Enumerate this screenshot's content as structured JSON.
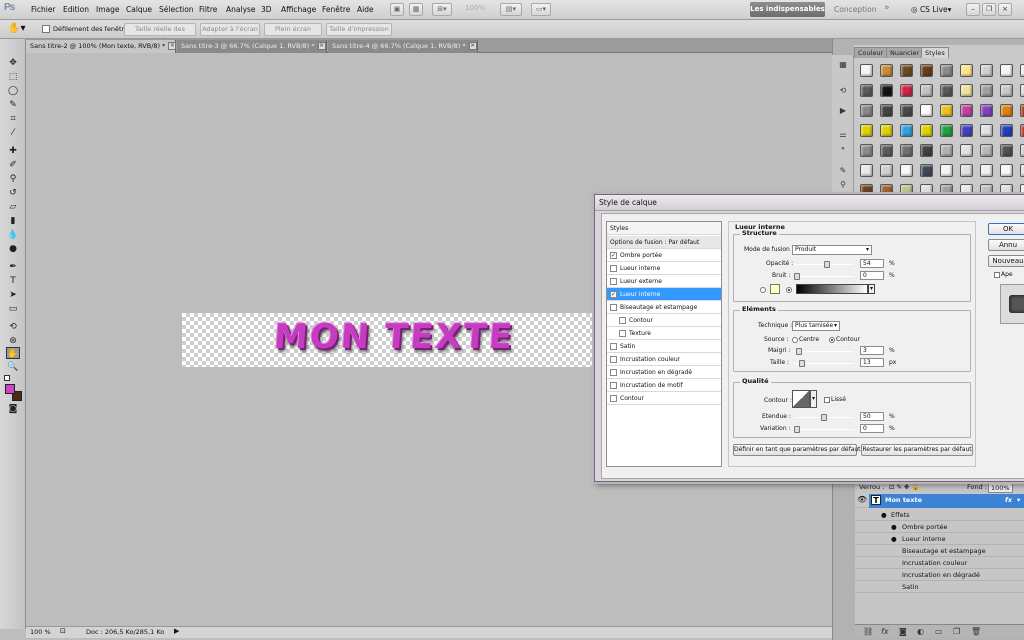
{
  "app": {
    "logo": "Ps"
  },
  "menu": [
    "Fichier",
    "Edition",
    "Image",
    "Calque",
    "Sélection",
    "Filtre",
    "Analyse",
    "3D",
    "Affichage",
    "Fenêtre",
    "Aide"
  ],
  "menubar": {
    "zoom": "100%",
    "workspace_active": "Les indispensables",
    "workspace_other": "Conception",
    "more": "»",
    "cslive": "CS Live"
  },
  "options": {
    "scroll_all": "Défilement des fenêtres",
    "btn_actual": "Taille réelle des pixels",
    "btn_fit": "Adapter à l'écran",
    "btn_full": "Plein écran",
    "btn_print": "Taille d'impression"
  },
  "tabs": [
    {
      "label": "Sans titre-2 @ 100% (Mon texte, RVB/8) *",
      "close": "×"
    },
    {
      "label": "Sans titre-3 @ 66.7% (Calque 1, RVB/8) *",
      "close": "×"
    },
    {
      "label": "Sans titre-4 @ 66.7% (Calque 1, RVB/8) *",
      "close": "×"
    }
  ],
  "artwork": {
    "text": "MON TEXTE"
  },
  "status": {
    "zoom": "100 %",
    "doc": "Doc : 206,5 Ko/285,1 Ko"
  },
  "panels": {
    "tabs": [
      "Couleur",
      "Nuancier",
      "Styles"
    ]
  },
  "colors": {
    "foreground": "#cc44cc",
    "background": "#4a2a10",
    "selected": "#3399ff"
  },
  "swatch_colors": [
    "#f4f4f4",
    "#c88a3a",
    "#6a4a20",
    "#6e3a1a",
    "#8a8a8a",
    "#ffe28a",
    "#cfcfcf",
    "#f7f7f7",
    "#eeeeee",
    "#5a5a5a",
    "#111111",
    "#cc2244",
    "#c2c2c2",
    "#585858",
    "#f0e0a0",
    "#a0a0a0",
    "#c8c8c8",
    "#dddddd",
    "#888888",
    "#444444",
    "#4a4a4a",
    "#ffffff",
    "#e8c020",
    "#c040a0",
    "#8040c0",
    "#e08010",
    "#b03010",
    "#e0d000",
    "#e0d000",
    "#30a0e0",
    "#e0d000",
    "#20a040",
    "#4040c0",
    "#e0e0e0",
    "#2040c0",
    "#c03020",
    "#8a8a8a",
    "#5a5a5a",
    "#707070",
    "#404040",
    "#b0b0b0",
    "#e0e0e0",
    "#b8b8b8",
    "#505050",
    "#d0d0d0",
    "#e8e8e8",
    "#d0d0d0",
    "#f8f8f8",
    "#404858",
    "#f4f4f4",
    "#e0e0e0",
    "#f0f0f0",
    "#f8f8f8",
    "#e0e0e0",
    "#6a4020",
    "#a06030",
    "#c0c090",
    "#e0e0e0",
    "#a0a0a0",
    "#e8e8e8",
    "#c0c0c0",
    "#e0e0e0",
    "#f0f0f0"
  ],
  "layers": {
    "blend": "Verrou :",
    "fill": "Fond :",
    "fill_value": "100%",
    "layer_name": "Mon texte",
    "fx": "fx",
    "effects": "Effets",
    "items": [
      "Ombre portée",
      "Lueur interne",
      "Biseautage et estampage",
      "Incrustation couleur",
      "Incrustation en dégradé",
      "Satin"
    ]
  },
  "dialog": {
    "title": "Style de calque",
    "list": [
      "Styles",
      "Options de fusion : Par défaut",
      "Ombre portée",
      "Lueur interne",
      "Lueur externe",
      "Lueur interne",
      "Biseautage et estampage",
      "Contour",
      "Texture",
      "Satin",
      "Incrustation couleur",
      "Incrustation en dégradé",
      "Incrustation de motif",
      "Contour"
    ],
    "section": "Lueur interne",
    "structure": "Structure",
    "blend_label": "Mode de fusion :",
    "blend_value": "Produit",
    "opacity_label": "Opacité :",
    "opacity": "54",
    "pct": "%",
    "noise_label": "Bruit :",
    "noise": "0",
    "elements": "Eléments",
    "technique_label": "Technique :",
    "technique_value": "Plus tamisée",
    "source_label": "Source :",
    "source_center": "Centre",
    "source_edge": "Contour",
    "choke_label": "Maigri :",
    "choke": "3",
    "size_label": "Taille :",
    "size": "13",
    "px": "px",
    "quality": "Qualité",
    "contour_label": "Contour :",
    "antialias": "Lissé",
    "range_label": "Etendue :",
    "range": "50",
    "jitter_label": "Variation :",
    "jitter": "0",
    "btn_default_set": "Définir en tant que paramètres par défaut",
    "btn_default_reset": "Restaurer les paramètres par défaut",
    "ok": "OK",
    "cancel": "Annu",
    "new": "Nouveau",
    "preview": "Ape"
  }
}
